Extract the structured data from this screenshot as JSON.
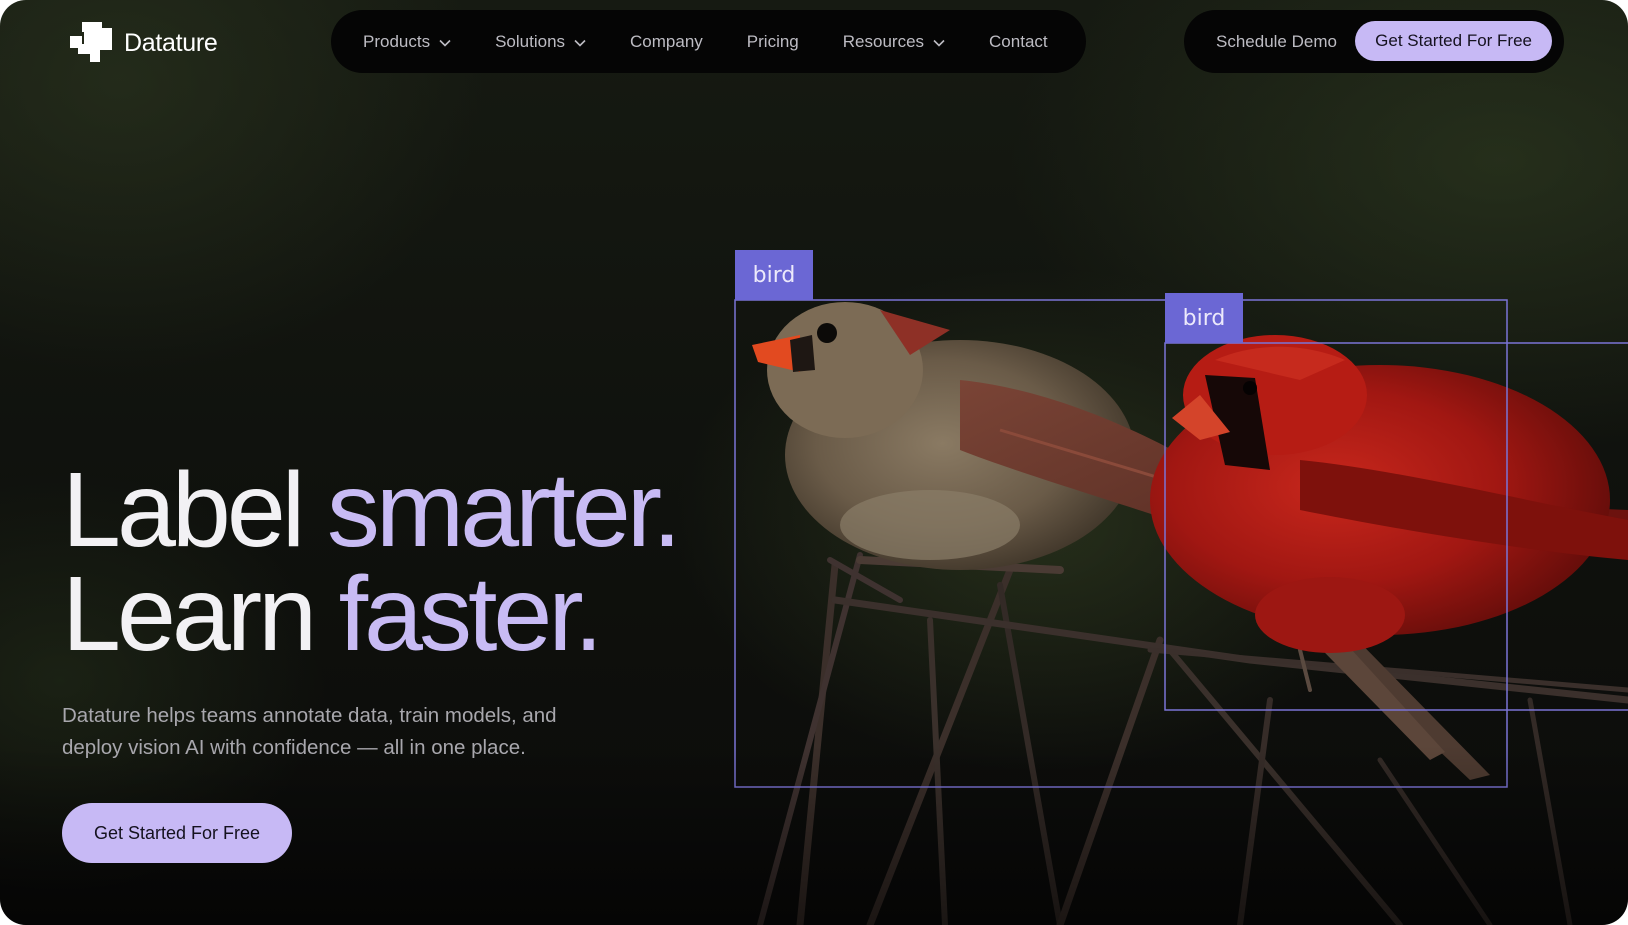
{
  "brand": {
    "name": "Datature"
  },
  "nav": {
    "items": [
      {
        "label": "Products",
        "has_dropdown": true
      },
      {
        "label": "Solutions",
        "has_dropdown": true
      },
      {
        "label": "Company",
        "has_dropdown": false
      },
      {
        "label": "Pricing",
        "has_dropdown": false
      },
      {
        "label": "Resources",
        "has_dropdown": true
      },
      {
        "label": "Contact",
        "has_dropdown": false
      }
    ],
    "schedule_demo": "Schedule Demo",
    "get_started": "Get Started For Free"
  },
  "hero": {
    "line1_white": "Label ",
    "line1_accent": "smarter.",
    "line2_white": "Learn ",
    "line2_accent": "faster.",
    "subtitle": "Datature helps teams annotate data, train models, and deploy vision AI with confidence — all in one place.",
    "cta": "Get Started For Free"
  },
  "detections": [
    {
      "label": "bird"
    },
    {
      "label": "bird"
    }
  ],
  "colors": {
    "accent": "#c7b9f5",
    "bbox": "#7b74d6",
    "bbox_tag": "#6b67d4",
    "nav_bg": "#050505"
  }
}
